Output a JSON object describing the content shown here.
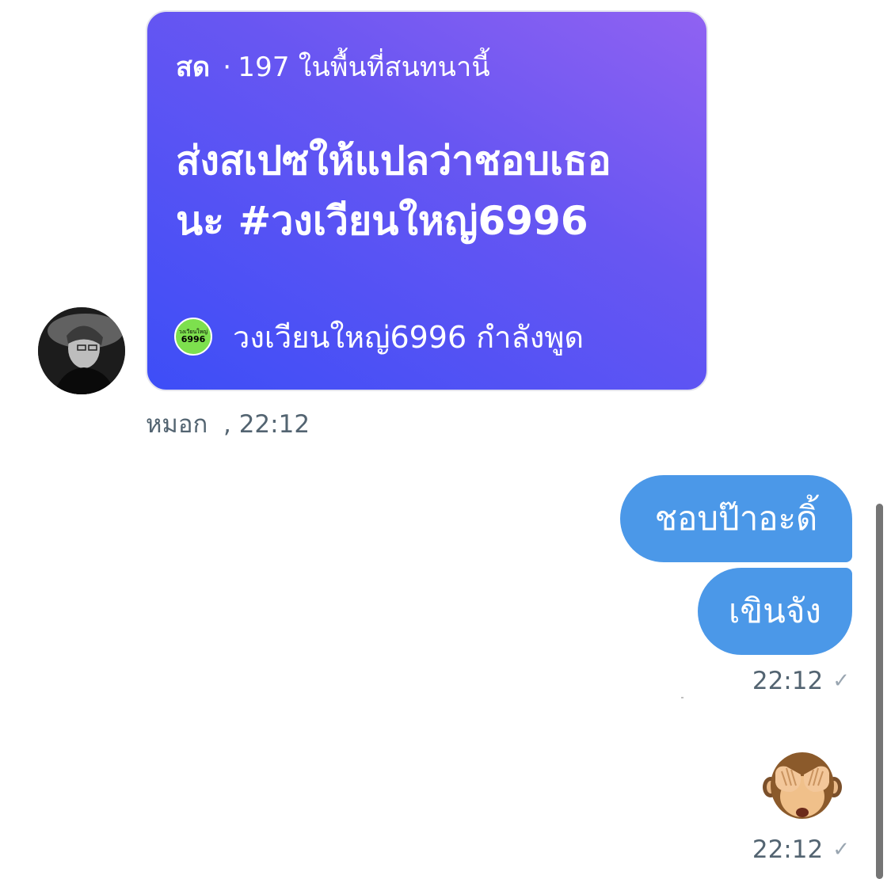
{
  "incoming": {
    "space_card": {
      "live_label": "สด",
      "separator": "·",
      "listener_count": "197 ในพื้นที่สนทนานี้",
      "title_lines": [
        "ส่งสเปซให้แปลว่าชอบเธอ",
        "นะ #วงเวียนใหญ่6996"
      ],
      "host_avatar_text": "วงเวียนใหญ่",
      "host_avatar_number": "6996",
      "host_name": "วงเวียนใหญ่6996",
      "host_status": "กำลังพูด",
      "gradient_colors": [
        "#9062f2",
        "#6856f2",
        "#3d4ef7"
      ]
    },
    "sender": "หมอก",
    "meta_separator": ",",
    "time": "22:12"
  },
  "outgoing": {
    "bubble_color": "#4b98e8",
    "messages": [
      {
        "text": "ชอบป๊าอะดิ้"
      },
      {
        "text": "เขินจัง"
      }
    ],
    "time_1": "22:12",
    "emoji_name": "see-no-evil-monkey-icon",
    "time_2": "22:12",
    "status_icon": "check-icon"
  }
}
